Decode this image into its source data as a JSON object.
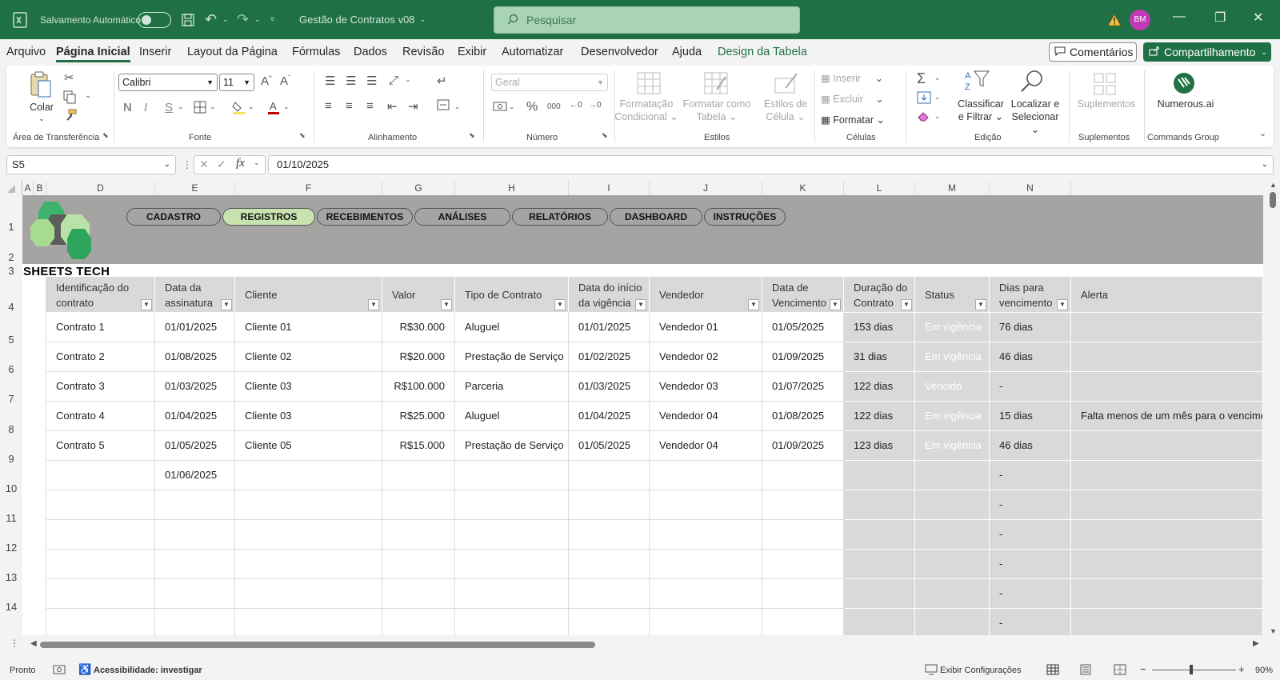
{
  "titlebar": {
    "autosave_label": "Salvamento Automático",
    "document_title": "Gestão de Contratos v08",
    "search_placeholder": "Pesquisar",
    "avatar_initials": "BM"
  },
  "menu": {
    "tabs": [
      "Arquivo",
      "Página Inicial",
      "Inserir",
      "Layout da Página",
      "Fórmulas",
      "Dados",
      "Revisão",
      "Exibir",
      "Automatizar",
      "Desenvolvedor",
      "Ajuda",
      "Design da Tabela"
    ],
    "comments_label": "Comentários",
    "share_label": "Compartilhamento"
  },
  "ribbon": {
    "clipboard": {
      "paste_label": "Colar",
      "group_label": "Área de Transferência"
    },
    "font": {
      "font_name": "Calibri",
      "font_size": "11",
      "group_label": "Fonte"
    },
    "alignment": {
      "group_label": "Alinhamento"
    },
    "number": {
      "format": "Geral",
      "group_label": "Número"
    },
    "styles": {
      "conditional_1": "Formatação",
      "conditional_2": "Condicional",
      "table_1": "Formatar como",
      "table_2": "Tabela",
      "cell_1": "Estilos de",
      "cell_2": "Célula",
      "group_label": "Estilos"
    },
    "cells": {
      "insert": "Inserir",
      "delete": "Excluir",
      "format": "Formatar",
      "group_label": "Células"
    },
    "editing": {
      "sort_1": "Classificar",
      "sort_2": "e Filtrar",
      "find_1": "Localizar e",
      "find_2": "Selecionar",
      "group_label": "Edição"
    },
    "addins": {
      "label": "Suplementos",
      "group_label": "Suplementos"
    },
    "commands": {
      "label": "Numerous.ai",
      "group_label": "Commands Group"
    }
  },
  "formula_bar": {
    "name_box": "S5",
    "formula": "01/10/2025"
  },
  "columns": [
    "A",
    "B",
    "D",
    "E",
    "F",
    "G",
    "H",
    "I",
    "J",
    "K",
    "L",
    "M",
    "N"
  ],
  "rows": [
    "1",
    "2",
    "3",
    "4",
    "5",
    "6",
    "7",
    "8",
    "9",
    "10",
    "11",
    "12",
    "13",
    "14"
  ],
  "nav_buttons": [
    "CADASTRO",
    "REGISTROS",
    "RECEBIMENTOS",
    "ANÁLISES",
    "RELATÓRIOS",
    "DASHBOARD",
    "INSTRUÇÕES"
  ],
  "brand": "SHEETS TECH",
  "table": {
    "headers": [
      [
        "Identificação do",
        "contrato"
      ],
      [
        "Data da",
        "assinatura"
      ],
      [
        "Cliente",
        ""
      ],
      [
        "Valor",
        ""
      ],
      [
        "Tipo de Contrato",
        ""
      ],
      [
        "Data do início",
        "da vigência"
      ],
      [
        "Vendedor",
        ""
      ],
      [
        "Data de",
        "Vencimento"
      ],
      [
        "Duração do",
        "Contrato"
      ],
      [
        "Status",
        ""
      ],
      [
        "Dias para",
        "vencimento"
      ],
      [
        "Alerta",
        ""
      ]
    ],
    "rows": [
      [
        "Contrato 1",
        "01/01/2025",
        "Cliente 01",
        "R$30.000",
        "Aluguel",
        "01/01/2025",
        "Vendedor 01",
        "01/05/2025",
        "153 dias",
        "Em vigência",
        "76 dias",
        ""
      ],
      [
        "Contrato 2",
        "01/08/2025",
        "Cliente 02",
        "R$20.000",
        "Prestação de Serviço",
        "01/02/2025",
        "Vendedor 02",
        "01/09/2025",
        "31 dias",
        "Em vigência",
        "46 dias",
        ""
      ],
      [
        "Contrato 3",
        "01/03/2025",
        "Cliente 03",
        "R$100.000",
        "Parceria",
        "01/03/2025",
        "Vendedor 03",
        "01/07/2025",
        "122 dias",
        "Vencido",
        "-",
        ""
      ],
      [
        "Contrato 4",
        "01/04/2025",
        "Cliente 03",
        "R$25.000",
        "Aluguel",
        "01/04/2025",
        "Vendedor 04",
        "01/08/2025",
        "122 dias",
        "Em vigência",
        "15 dias",
        "Falta menos de um mês para o vencimento"
      ],
      [
        "Contrato 5",
        "01/05/2025",
        "Cliente 05",
        "R$15.000",
        "Prestação de Serviço",
        "01/05/2025",
        "Vendedor 04",
        "01/09/2025",
        "123 dias",
        "Em vigência",
        "46 dias",
        ""
      ],
      [
        "",
        "01/06/2025",
        "",
        "",
        "",
        "",
        "",
        "",
        "",
        "",
        "-",
        ""
      ],
      [
        "",
        "",
        "",
        "",
        "",
        "",
        "",
        "",
        "",
        "",
        "-",
        ""
      ],
      [
        "",
        "",
        "",
        "",
        "",
        "",
        "",
        "",
        "",
        "",
        "-",
        ""
      ],
      [
        "",
        "",
        "",
        "",
        "",
        "",
        "",
        "",
        "",
        "",
        "-",
        ""
      ],
      [
        "",
        "",
        "",
        "",
        "",
        "",
        "",
        "",
        "",
        "",
        "-",
        ""
      ],
      [
        "",
        "",
        "",
        "",
        "",
        "",
        "",
        "",
        "",
        "",
        "-",
        ""
      ]
    ]
  },
  "statusbar": {
    "ready": "Pronto",
    "accessibility": "Acessibilidade: investigar",
    "display_settings": "Exibir Configurações",
    "zoom": "90%"
  },
  "colors": {
    "excel_green": "#1f7145",
    "status_ok": "#375623",
    "status_expired": "#c00000",
    "banner_gray": "#a6a3a3"
  }
}
